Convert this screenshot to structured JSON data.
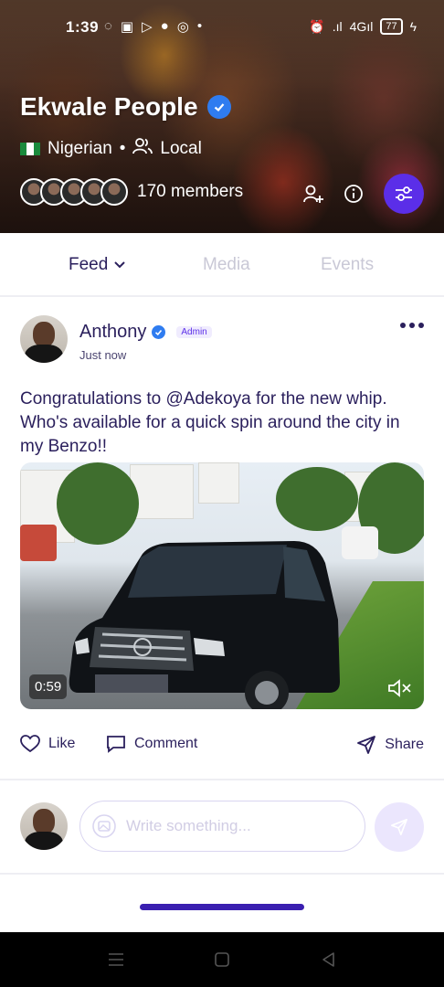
{
  "status_bar": {
    "time": "1:39",
    "left_icons": [
      "whatsapp-icon",
      "game-icon",
      "video-icon",
      "chat-icon",
      "instagram-icon",
      "dot-icon"
    ],
    "right_icons": [
      "alarm-icon",
      "signal-icon",
      "network-icon"
    ],
    "network_label": "4G",
    "battery": "77"
  },
  "group": {
    "name": "Ekwale People",
    "nationality": "Nigerian",
    "separator": "•",
    "type": "Local",
    "members_label": "170 members",
    "accent": "#5b2ee8"
  },
  "tabs": {
    "feed": "Feed",
    "media": "Media",
    "events": "Events"
  },
  "post": {
    "author": "Anthony",
    "badge": "Admin",
    "time": "Just now",
    "text": "Congratulations to @Adekoya for the new whip. Who's available for a quick spin around the city in my Benzo!!",
    "video_duration": "0:59",
    "actions": {
      "like": "Like",
      "comment": "Comment",
      "share": "Share"
    }
  },
  "composer": {
    "placeholder": "Write something..."
  }
}
